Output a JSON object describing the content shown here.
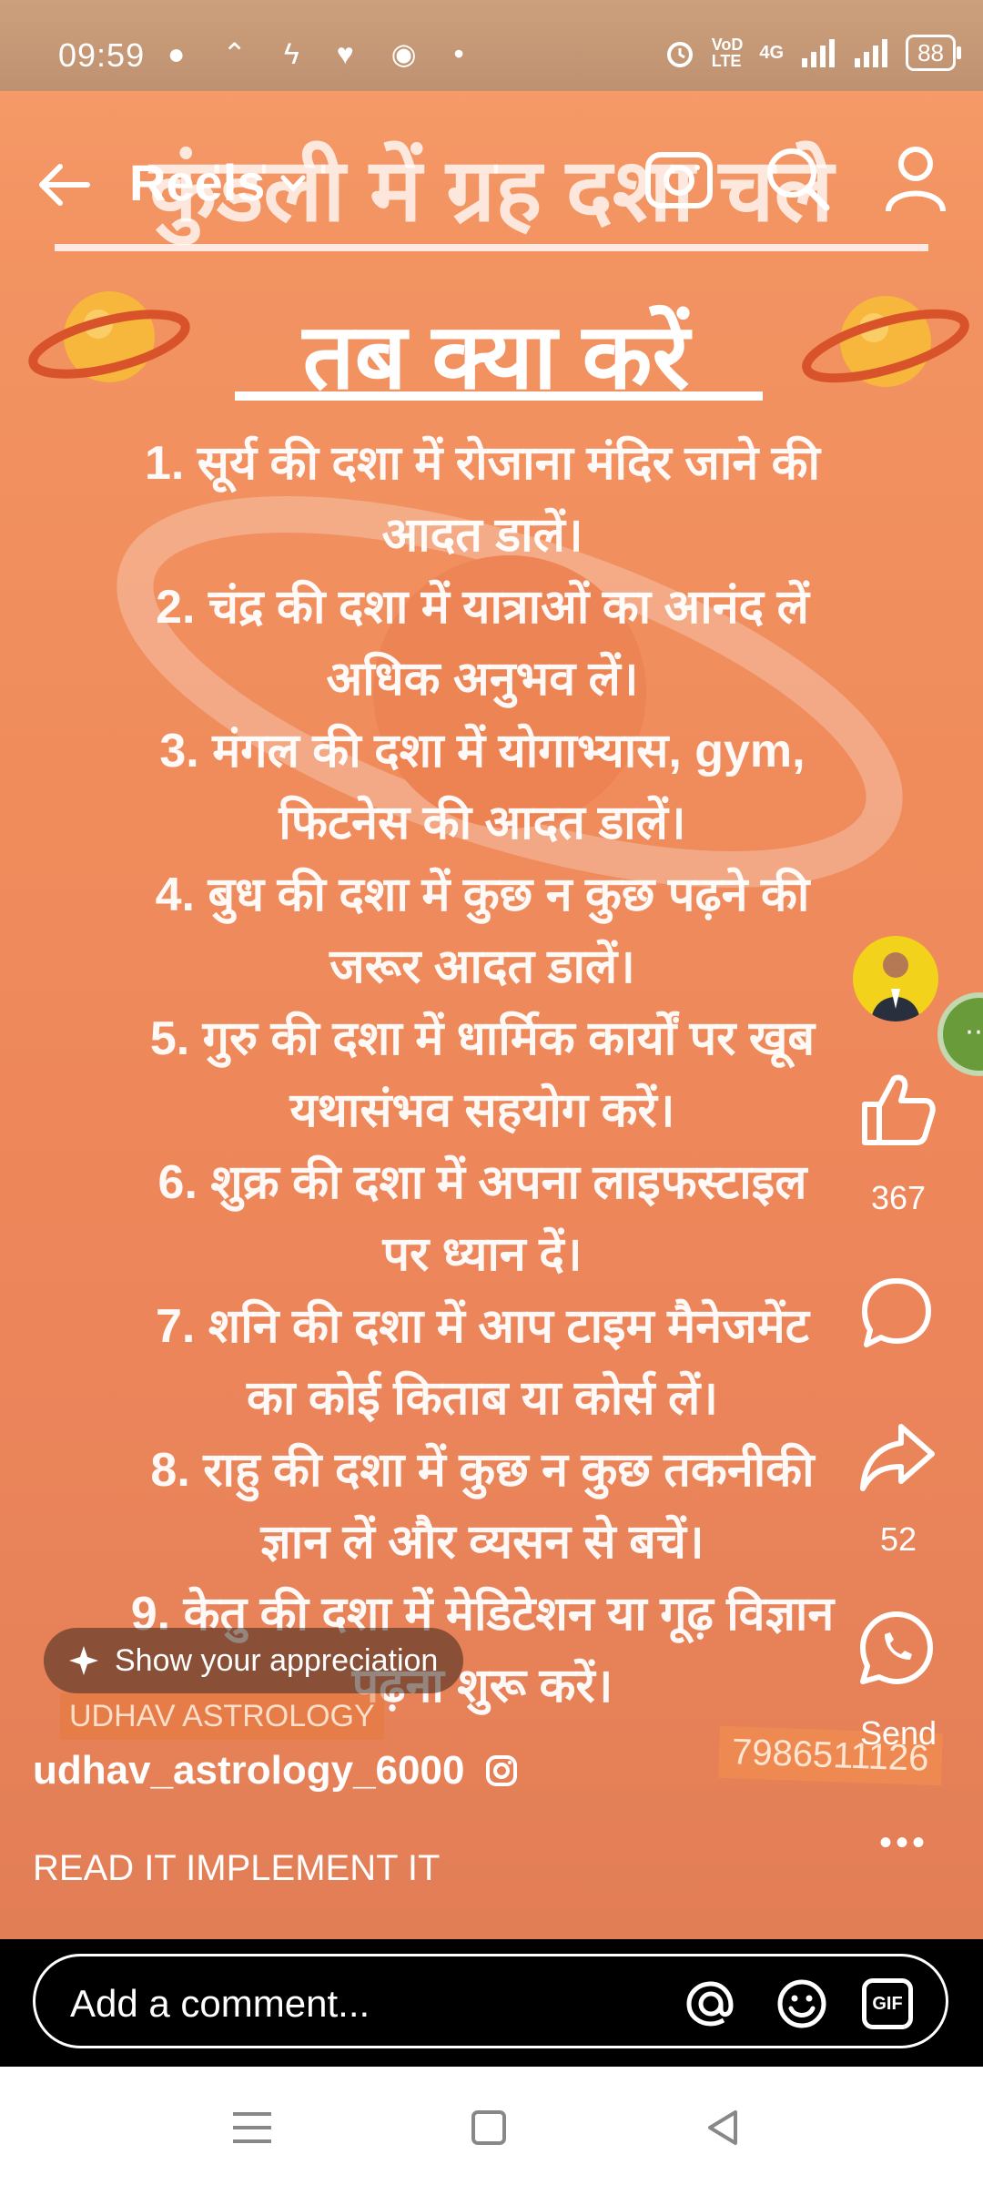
{
  "status_bar": {
    "time": "09:59",
    "left_icons": "● ⌃ ϟ ♥ ◉ •",
    "network_top": "VoD",
    "network_bottom": "LTE",
    "signal_label": "4G",
    "battery": "88"
  },
  "top_bar": {
    "title": "Reels"
  },
  "poster": {
    "watermark_title": "कुंडली में ग्रह दशा चले",
    "headline": "तब क्या करें",
    "tips": [
      "1. सूर्य की दशा में रोजाना मंदिर जाने की",
      "आदत डालें।",
      "2. चंद्र की दशा में यात्राओं का आनंद लें",
      "अधिक अनुभव लें।",
      "3. मंगल की दशा में योगाभ्यास, gym,",
      "फिटनेस की आदत डालें।",
      "4. बुध की दशा में कुछ न कुछ पढ़ने की",
      "जरूर आदत डालें।",
      "5. गुरु की दशा में धार्मिक कार्यों पर खूब",
      "यथासंभव सहयोग करें।",
      "6. शुक्र की दशा में अपना लाइफस्टाइल",
      "पर ध्यान दें।",
      "7. शनि की दशा में आप टाइम मैनेजमेंट",
      "का कोई किताब या कोर्स लें।",
      "8. राहु की दशा में कुछ न कुछ तकनीकी",
      "ज्ञान लें और व्यसन से बचें।",
      "9. केतु की दशा में मेडिटेशन या गूढ़ विज्ञान",
      "पढ़ना शुरू करें।"
    ],
    "brand_watermark": "UDHAV ASTROLOGY",
    "phone_watermark": "7986511126"
  },
  "actions": {
    "likes": "367",
    "shares": "52",
    "send_label": "Send"
  },
  "appreciate_label": "Show your appreciation",
  "reel": {
    "username": "udhav_astrology_6000",
    "caption": "READ IT IMPLEMENT IT",
    "more": "•••"
  },
  "comment": {
    "placeholder": "Add a comment...",
    "gif_label": "GIF"
  },
  "colors": {
    "background": "#f08c5c",
    "avatar_bg": "#f3d21b",
    "bubble": "#6a9b3a"
  }
}
